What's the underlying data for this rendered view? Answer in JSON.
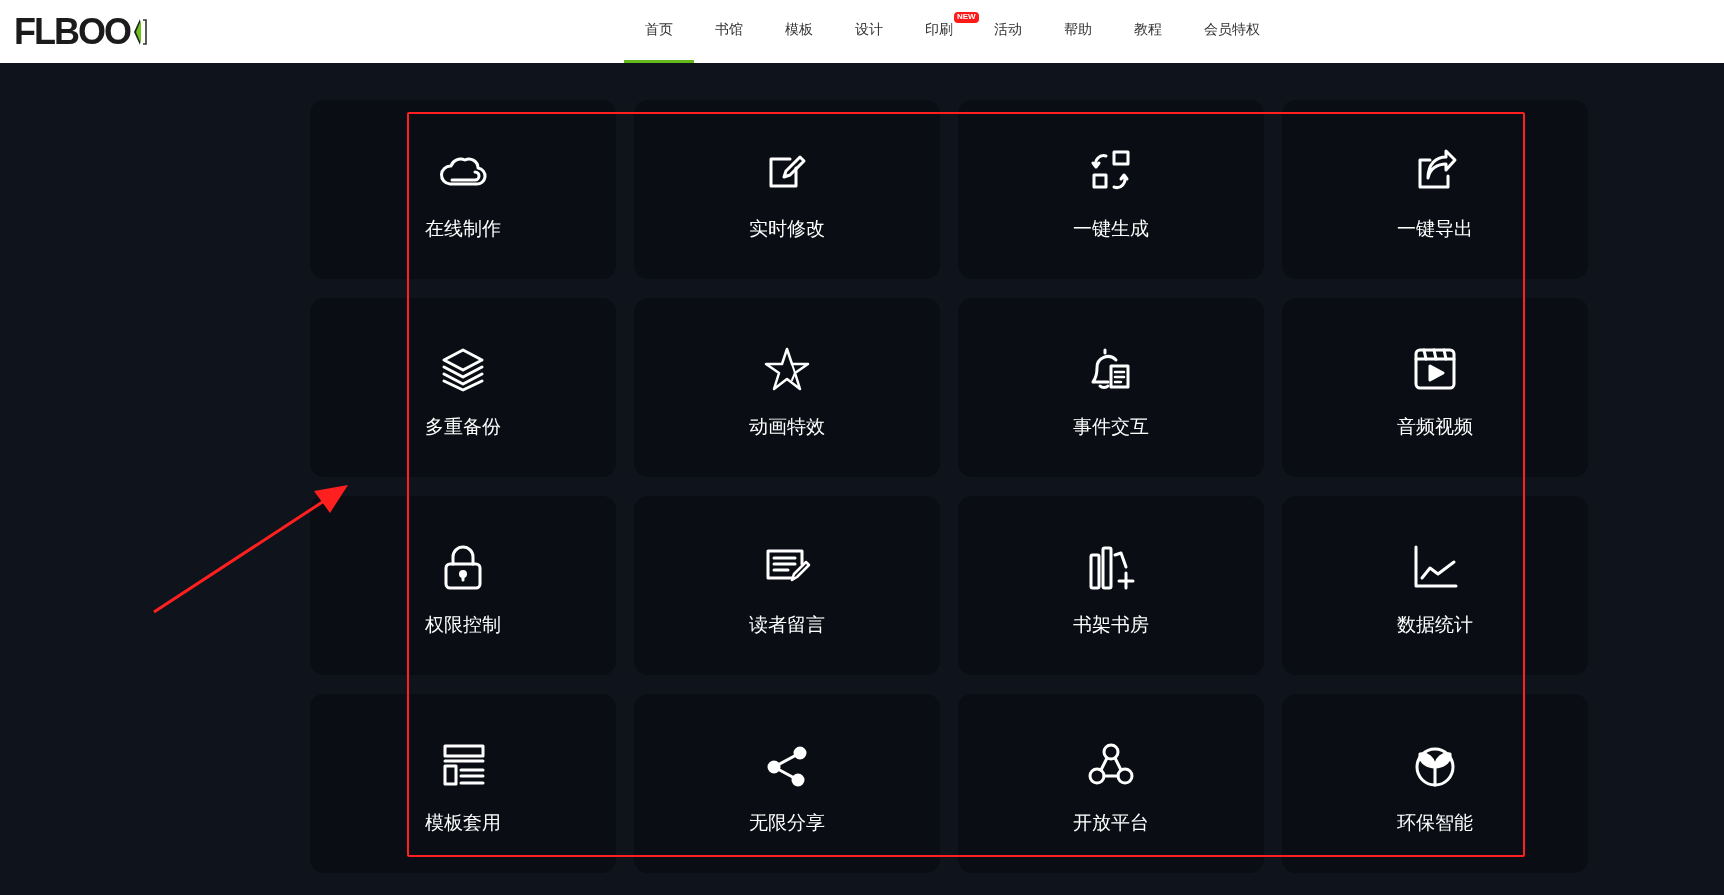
{
  "header": {
    "logo": "FLBOO",
    "nav": [
      {
        "label": "首页",
        "selected": true
      },
      {
        "label": "书馆",
        "selected": false
      },
      {
        "label": "模板",
        "selected": false
      },
      {
        "label": "设计",
        "selected": false
      },
      {
        "label": "印刷",
        "selected": false,
        "badge": "NEW"
      },
      {
        "label": "活动",
        "selected": false
      },
      {
        "label": "帮助",
        "selected": false
      },
      {
        "label": "教程",
        "selected": false
      },
      {
        "label": "会员特权",
        "selected": false
      }
    ]
  },
  "features": [
    {
      "kind": "cloud",
      "label": "在线制作"
    },
    {
      "kind": "edit",
      "label": "实时修改"
    },
    {
      "kind": "generate",
      "label": "一键生成"
    },
    {
      "kind": "export",
      "label": "一键导出"
    },
    {
      "kind": "layers",
      "label": "多重备份"
    },
    {
      "kind": "star",
      "label": "动画特效"
    },
    {
      "kind": "bell",
      "label": "事件交互"
    },
    {
      "kind": "video",
      "label": "音频视频"
    },
    {
      "kind": "lock",
      "label": "权限控制"
    },
    {
      "kind": "note",
      "label": "读者留言"
    },
    {
      "kind": "books",
      "label": "书架书房"
    },
    {
      "kind": "chart",
      "label": "数据统计"
    },
    {
      "kind": "template",
      "label": "模板套用"
    },
    {
      "kind": "share",
      "label": "无限分享"
    },
    {
      "kind": "nodes",
      "label": "开放平台"
    },
    {
      "kind": "leaf",
      "label": "环保智能"
    }
  ]
}
